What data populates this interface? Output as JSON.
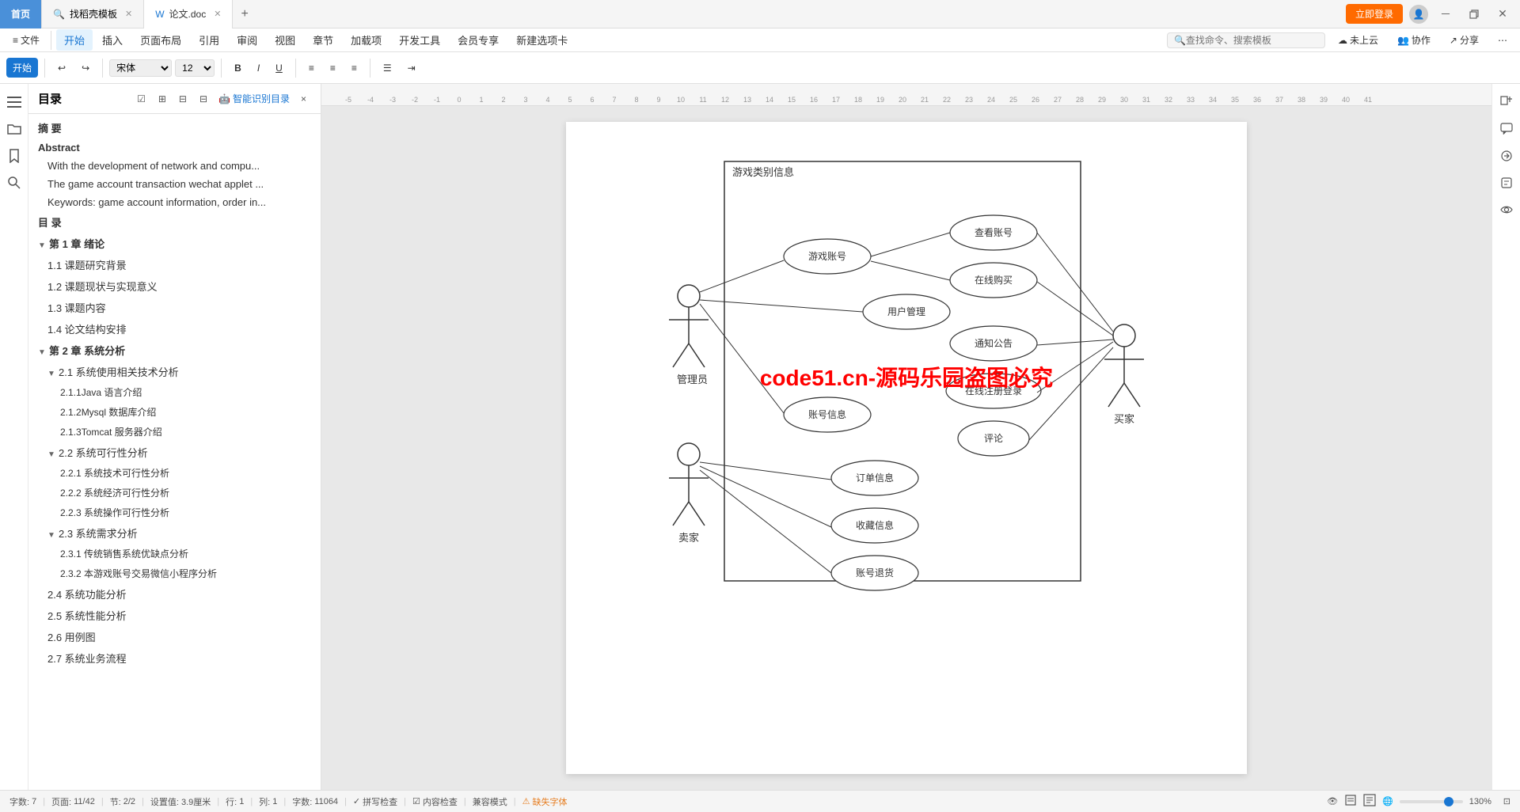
{
  "titlebar": {
    "tabs": [
      {
        "id": "home",
        "label": "首页",
        "icon": "🏠",
        "active": false,
        "closable": false,
        "class": "home"
      },
      {
        "id": "template",
        "label": "找稻壳模板",
        "icon": "🔍",
        "active": false,
        "closable": true
      },
      {
        "id": "doc",
        "label": "论文.doc",
        "icon": "📄",
        "active": true,
        "closable": true
      }
    ],
    "register_btn": "立即登录",
    "win_minimize": "－",
    "win_restore": "❐",
    "win_close": "✕"
  },
  "ribbon": {
    "items": [
      "文件",
      "开始",
      "插入",
      "页面布局",
      "引用",
      "审阅",
      "视图",
      "章节",
      "加载项",
      "开发工具",
      "会员专享",
      "新建选项卡"
    ],
    "active": "开始",
    "search_placeholder": "查找命令、搜索模板",
    "cloud_status": "未上云",
    "collab": "协作",
    "share": "分享"
  },
  "toolbar": {
    "file_btn": "≡ 文件",
    "undo": "↩",
    "redo": "↪",
    "start_btn": "开始",
    "insert_btn": "插入",
    "layout_btn": "页面布局",
    "ref_btn": "引用"
  },
  "sidebar": {
    "title": "目录",
    "close": "×",
    "tools": [
      "☑",
      "⊞",
      "⊟",
      "⊟"
    ],
    "smart_identify": "智能识别目录",
    "toc": [
      {
        "level": 1,
        "label": "摘  要",
        "arrow": ""
      },
      {
        "level": 1,
        "label": "Abstract",
        "arrow": ""
      },
      {
        "level": 2,
        "label": "With the development of network and compu...",
        "arrow": ""
      },
      {
        "level": 2,
        "label": "The game account transaction wechat applet ...",
        "arrow": ""
      },
      {
        "level": 2,
        "label": "Keywords: game account information, order in...",
        "arrow": ""
      },
      {
        "level": 1,
        "label": "目  录",
        "arrow": ""
      },
      {
        "level": 1,
        "label": "第 1 章  绪论",
        "arrow": "▼",
        "expanded": true
      },
      {
        "level": 2,
        "label": "1.1 课题研究背景",
        "arrow": ""
      },
      {
        "level": 2,
        "label": "1.2 课题现状与实现意义",
        "arrow": ""
      },
      {
        "level": 2,
        "label": "1.3 课题内容",
        "arrow": ""
      },
      {
        "level": 2,
        "label": "1.4 论文结构安排",
        "arrow": ""
      },
      {
        "level": 1,
        "label": "第 2 章  系统分析",
        "arrow": "▼",
        "expanded": true
      },
      {
        "level": 2,
        "label": "2.1 系统使用相关技术分析",
        "arrow": "▼",
        "expanded": true
      },
      {
        "level": 3,
        "label": "2.1.1Java 语言介绍",
        "arrow": ""
      },
      {
        "level": 3,
        "label": "2.1.2Mysql 数据库介绍",
        "arrow": ""
      },
      {
        "level": 3,
        "label": "2.1.3Tomcat 服务器介绍",
        "arrow": ""
      },
      {
        "level": 2,
        "label": "2.2 系统可行性分析",
        "arrow": "▼",
        "expanded": true
      },
      {
        "level": 3,
        "label": "2.2.1 系统技术可行性分析",
        "arrow": ""
      },
      {
        "level": 3,
        "label": "2.2.2 系统经济可行性分析",
        "arrow": ""
      },
      {
        "level": 3,
        "label": "2.2.3 系统操作可行性分析",
        "arrow": ""
      },
      {
        "level": 2,
        "label": "2.3 系统需求分析",
        "arrow": "▼",
        "expanded": true
      },
      {
        "level": 3,
        "label": "2.3.1 传统销售系统优缺点分析",
        "arrow": ""
      },
      {
        "level": 3,
        "label": "2.3.2 本游戏账号交易微信小程序分析",
        "arrow": ""
      },
      {
        "level": 2,
        "label": "2.4 系统功能分析",
        "arrow": ""
      },
      {
        "level": 2,
        "label": "2.5 系统性能分析",
        "arrow": ""
      },
      {
        "level": 2,
        "label": "2.6 用例图",
        "arrow": ""
      },
      {
        "level": 2,
        "label": "2.7 系统业务流程",
        "arrow": ""
      }
    ]
  },
  "uml": {
    "title": "游戏类别信息",
    "actors": {
      "admin": "管理员",
      "seller": "卖家",
      "buyer": "买家"
    },
    "usecases": [
      "游戏账号",
      "查看账号",
      "在线购买",
      "用户管理",
      "通知公告",
      "在线注册登录",
      "账号信息",
      "评论",
      "订单信息",
      "收藏信息",
      "账号退货"
    ],
    "watermark": "code51.cn-源码乐园盗图必究"
  },
  "ruler": {
    "numbers": [
      "-5",
      "-4",
      "-3",
      "-2",
      "-1",
      "0",
      "1",
      "2",
      "3",
      "4",
      "5",
      "6",
      "7",
      "8",
      "9",
      "10",
      "11",
      "12",
      "13",
      "14",
      "15",
      "16",
      "17",
      "18",
      "19",
      "20",
      "21",
      "22",
      "23",
      "24",
      "25",
      "26",
      "27",
      "28",
      "29",
      "30",
      "31",
      "32",
      "33",
      "34",
      "35",
      "36",
      "37",
      "38",
      "39",
      "40",
      "41"
    ]
  },
  "status_bar": {
    "word_count_label": "字数:",
    "word_count_value": "7",
    "page_label": "页面:",
    "page_value": "11/42",
    "section_label": "节:",
    "section_value": "2/2",
    "position_label": "设置值:",
    "position_value": "3.9厘米",
    "line_label": "行:",
    "line_value": "1",
    "col_label": "列:",
    "col_value": "1",
    "char_count_label": "字数:",
    "char_count_value": "11064",
    "spell_check": "✓ 拼写检查",
    "content_check": "☑ 内容检查",
    "compat_mode": "兼容模式",
    "missing_font": "⚠ 缺失字体",
    "zoom_value": "130%"
  }
}
